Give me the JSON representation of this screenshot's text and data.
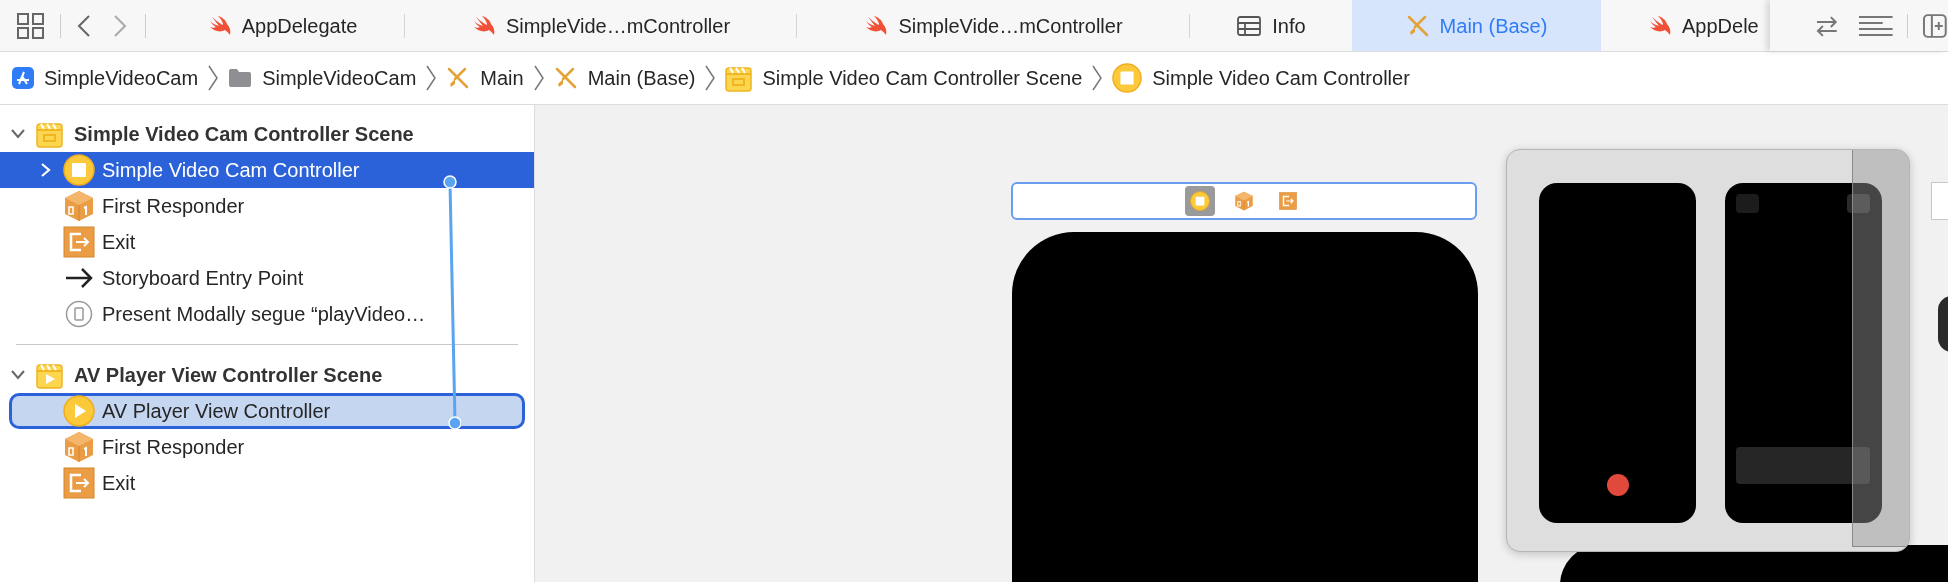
{
  "tabs": [
    {
      "label": "AppDelegate",
      "kind": "swift",
      "selected": false
    },
    {
      "label": "SimpleVide…mController",
      "kind": "swift",
      "selected": false
    },
    {
      "label": "SimpleVide…mController",
      "kind": "swift",
      "selected": false
    },
    {
      "label": "Info",
      "kind": "plist",
      "selected": false
    },
    {
      "label": "Main (Base)",
      "kind": "storyboard",
      "selected": true
    },
    {
      "label": "AppDele",
      "kind": "swift",
      "selected": false
    }
  ],
  "breadcrumbs": [
    {
      "label": "SimpleVideoCam",
      "kind": "app"
    },
    {
      "label": "SimpleVideoCam",
      "kind": "folder"
    },
    {
      "label": "Main",
      "kind": "storyboard"
    },
    {
      "label": "Main (Base)",
      "kind": "storyboard"
    },
    {
      "label": "Simple Video Cam Controller Scene",
      "kind": "scene"
    },
    {
      "label": "Simple Video Cam Controller",
      "kind": "controller"
    }
  ],
  "outline": [
    {
      "title": "Simple Video Cam Controller Scene",
      "kind": "scene",
      "expanded": true,
      "children": [
        {
          "label": "Simple Video Cam Controller",
          "kind": "controller",
          "selected": true,
          "highlighted": false,
          "expanded": false
        },
        {
          "label": "First Responder",
          "kind": "responder",
          "selected": false,
          "highlighted": false
        },
        {
          "label": "Exit",
          "kind": "exit",
          "selected": false,
          "highlighted": false
        },
        {
          "label": "Storyboard Entry Point",
          "kind": "entry",
          "selected": false,
          "highlighted": false
        },
        {
          "label": "Present Modally segue “playVideo…",
          "kind": "segue",
          "selected": false,
          "highlighted": false
        }
      ]
    },
    {
      "title": "AV Player View Controller Scene",
      "kind": "player-scene",
      "expanded": true,
      "children": [
        {
          "label": "AV Player View Controller",
          "kind": "player",
          "selected": false,
          "highlighted": true
        },
        {
          "label": "First Responder",
          "kind": "responder",
          "selected": false,
          "highlighted": false
        },
        {
          "label": "Exit",
          "kind": "exit",
          "selected": false,
          "highlighted": false
        }
      ]
    }
  ],
  "scene_dock": [
    {
      "kind": "controller",
      "selected": true
    },
    {
      "kind": "responder",
      "selected": false
    },
    {
      "kind": "exit",
      "selected": false
    }
  ]
}
